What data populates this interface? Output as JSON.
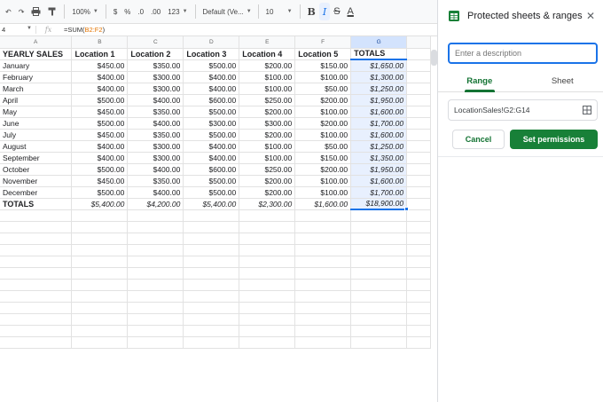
{
  "toolbar": {
    "zoom": "100%",
    "currency": "$",
    "percent": "%",
    "dec_decrease": ".0",
    "dec_increase": ".00",
    "more_formats": "123",
    "font": "Default (Ve...",
    "font_size": "10",
    "bold": "B",
    "italic": "I",
    "strike": "S",
    "text_color": "A"
  },
  "formula_bar": {
    "cell_ref": "4",
    "formula_prefix": "=SUM(",
    "formula_ref": "B2:F2",
    "formula_suffix": ")"
  },
  "sheet": {
    "columns": [
      "A",
      "B",
      "C",
      "D",
      "E",
      "F",
      "G"
    ],
    "selected_column": "G",
    "rows": [
      [
        "YEARLY SALES",
        "Location 1",
        "Location 2",
        "Location 3",
        "Location 4",
        "Location 5",
        "TOTALS"
      ],
      [
        "January",
        "$450.00",
        "$350.00",
        "$500.00",
        "$200.00",
        "$150.00",
        "$1,650.00"
      ],
      [
        "February",
        "$400.00",
        "$300.00",
        "$400.00",
        "$100.00",
        "$100.00",
        "$1,300.00"
      ],
      [
        "March",
        "$400.00",
        "$300.00",
        "$400.00",
        "$100.00",
        "$50.00",
        "$1,250.00"
      ],
      [
        "April",
        "$500.00",
        "$400.00",
        "$600.00",
        "$250.00",
        "$200.00",
        "$1,950.00"
      ],
      [
        "May",
        "$450.00",
        "$350.00",
        "$500.00",
        "$200.00",
        "$100.00",
        "$1,600.00"
      ],
      [
        "June",
        "$500.00",
        "$400.00",
        "$300.00",
        "$300.00",
        "$200.00",
        "$1,700.00"
      ],
      [
        "July",
        "$450.00",
        "$350.00",
        "$500.00",
        "$200.00",
        "$100.00",
        "$1,600.00"
      ],
      [
        "August",
        "$400.00",
        "$300.00",
        "$400.00",
        "$100.00",
        "$50.00",
        "$1,250.00"
      ],
      [
        "September",
        "$400.00",
        "$300.00",
        "$400.00",
        "$100.00",
        "$150.00",
        "$1,350.00"
      ],
      [
        "October",
        "$500.00",
        "$400.00",
        "$600.00",
        "$250.00",
        "$200.00",
        "$1,950.00"
      ],
      [
        "November",
        "$450.00",
        "$350.00",
        "$500.00",
        "$200.00",
        "$100.00",
        "$1,600.00"
      ],
      [
        "December",
        "$500.00",
        "$400.00",
        "$500.00",
        "$200.00",
        "$100.00",
        "$1,700.00"
      ],
      [
        "TOTALS",
        "$5,400.00",
        "$4,200.00",
        "$5,400.00",
        "$2,300.00",
        "$1,600.00",
        "$18,900.00"
      ]
    ]
  },
  "panel": {
    "title": "Protected sheets & ranges",
    "description_placeholder": "Enter a description",
    "tabs": [
      "Range",
      "Sheet"
    ],
    "active_tab": "Range",
    "range_value": "LocationSales!G2:G14",
    "cancel_label": "Cancel",
    "set_permissions_label": "Set permissions"
  },
  "colors": {
    "accent_green": "#188038",
    "selection_blue": "#1a73e8",
    "selection_fill": "#e8f0fe"
  }
}
